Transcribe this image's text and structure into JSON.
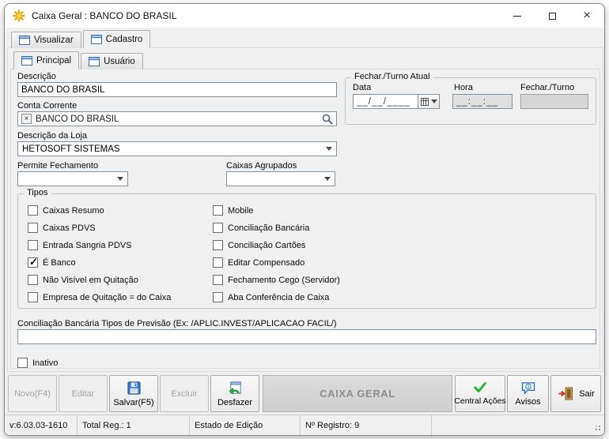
{
  "window": {
    "title": "Caixa Geral : BANCO DO BRASIL"
  },
  "tabs": {
    "visualizar": "Visualizar",
    "cadastro": "Cadastro",
    "principal": "Principal",
    "usuario": "Usuário"
  },
  "form": {
    "descricao": {
      "label": "Descrição",
      "value": "BANCO DO BRASIL"
    },
    "conta_corrente": {
      "label": "Conta Corrente",
      "value": "BANCO DO BRASIL"
    },
    "fechar_turno": {
      "title": "Fechar./Turno Atual",
      "data_label": "Data",
      "data_value": "__/__/____",
      "hora_label": "Hora",
      "hora_value": "__:__:__",
      "fechar_label": "Fechar./Turno",
      "fechar_value": ""
    },
    "descricao_loja": {
      "label": "Descrição da Loja",
      "value": "HETOSOFT SISTEMAS"
    },
    "permite_fechamento": {
      "label": "Permite Fechamento",
      "value": ""
    },
    "caixas_agrupados": {
      "label": "Caixas Agrupados",
      "value": ""
    },
    "tipos": {
      "title": "Tipos",
      "left": [
        {
          "label": "Caixas Resumo",
          "checked": false
        },
        {
          "label": "Caixas PDVS",
          "checked": false
        },
        {
          "label": "Entrada Sangria PDVS",
          "checked": false
        },
        {
          "label": "É Banco",
          "checked": true
        },
        {
          "label": "Não Visível em Quitação",
          "checked": false
        },
        {
          "label": "Empresa de Quitação = do Caixa",
          "checked": false
        }
      ],
      "right": [
        {
          "label": "Mobile",
          "checked": false
        },
        {
          "label": "Conciliação Bancária",
          "checked": false
        },
        {
          "label": "Conciliação Cartões",
          "checked": false
        },
        {
          "label": "Editar Compensado",
          "checked": false
        },
        {
          "label": "Fechamento Cego (Servidor)",
          "checked": false
        },
        {
          "label": "Aba Conferência de Caixa",
          "checked": false
        }
      ]
    },
    "conciliacao": {
      "label": "Conciliação Bancária Tipos de Previsão (Ex: /APLIC.INVEST/APLICACAO FACIL/)",
      "value": ""
    },
    "inativo": {
      "label": "Inativo",
      "checked": false
    }
  },
  "toolbar": {
    "novo": "Novo(F4)",
    "editar": "Editar",
    "salvar": "Salvar(F5)",
    "excluir": "Excluir",
    "desfazer": "Desfazer",
    "banner": "CAIXA GERAL",
    "central_acoes": "Central Ações",
    "avisos": "Avisos",
    "sair": "Sair"
  },
  "statusbar": {
    "version": "v:6.03.03-1610",
    "total": "Total Reg.: 1",
    "estado": "Estado de Edição",
    "registro": "Nº Registro: 9"
  }
}
